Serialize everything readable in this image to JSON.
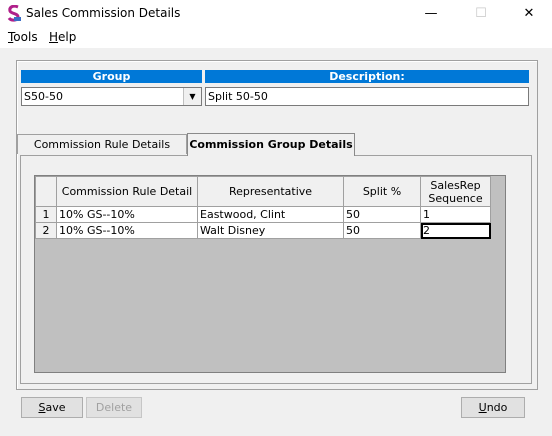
{
  "window": {
    "title": "Sales Commission Details",
    "minimize": "—",
    "maximize": "☐",
    "close": "✕"
  },
  "menu": {
    "tools_rest": "ools",
    "tools_key": "T",
    "help_rest": "elp",
    "help_key": "H"
  },
  "header": {
    "group_label": "Group",
    "description_label": "Description:",
    "group_value": "S50-50",
    "description_value": "Split 50-50"
  },
  "tabs": [
    {
      "label": "Commission Rule Details"
    },
    {
      "label": "Commission Group Details"
    }
  ],
  "grid": {
    "columns": [
      "Commission Rule Detail",
      "Representative",
      "Split %",
      "SalesRep Sequence"
    ],
    "rows": [
      {
        "num": "1",
        "rule": "10% GS--10%",
        "rep": "Eastwood, Clint",
        "split": "50",
        "seq": "1"
      },
      {
        "num": "2",
        "rule": "10% GS--10%",
        "rep": "Walt Disney",
        "split": "50",
        "seq": "2"
      }
    ]
  },
  "buttons": {
    "save_key": "S",
    "save_rest": "ave",
    "delete": "Delete",
    "undo_key": "U",
    "undo_rest": "ndo"
  },
  "colors": {
    "header_blue": "#0078d7",
    "app_icon": "#b0208a"
  }
}
